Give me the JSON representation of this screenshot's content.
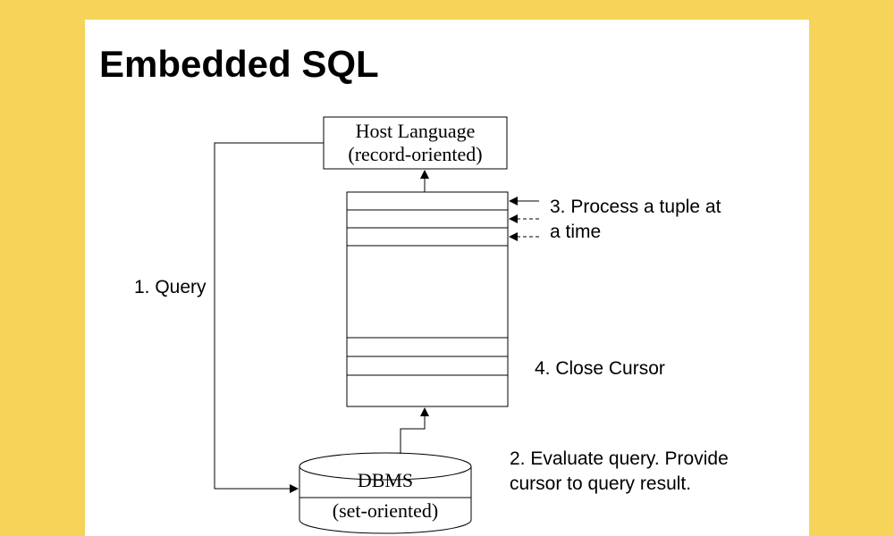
{
  "title": "Embedded SQL",
  "hostBox": {
    "line1": "Host Language",
    "line2": "(record-oriented)"
  },
  "dbms": {
    "line1": "DBMS",
    "line2": "(set-oriented)"
  },
  "steps": {
    "s1": "1. Query",
    "s3a": "3. Process a tuple at",
    "s3b": "a time",
    "s4": "4. Close Cursor",
    "s2a": "2. Evaluate query. Provide",
    "s2b": "cursor to query result."
  }
}
